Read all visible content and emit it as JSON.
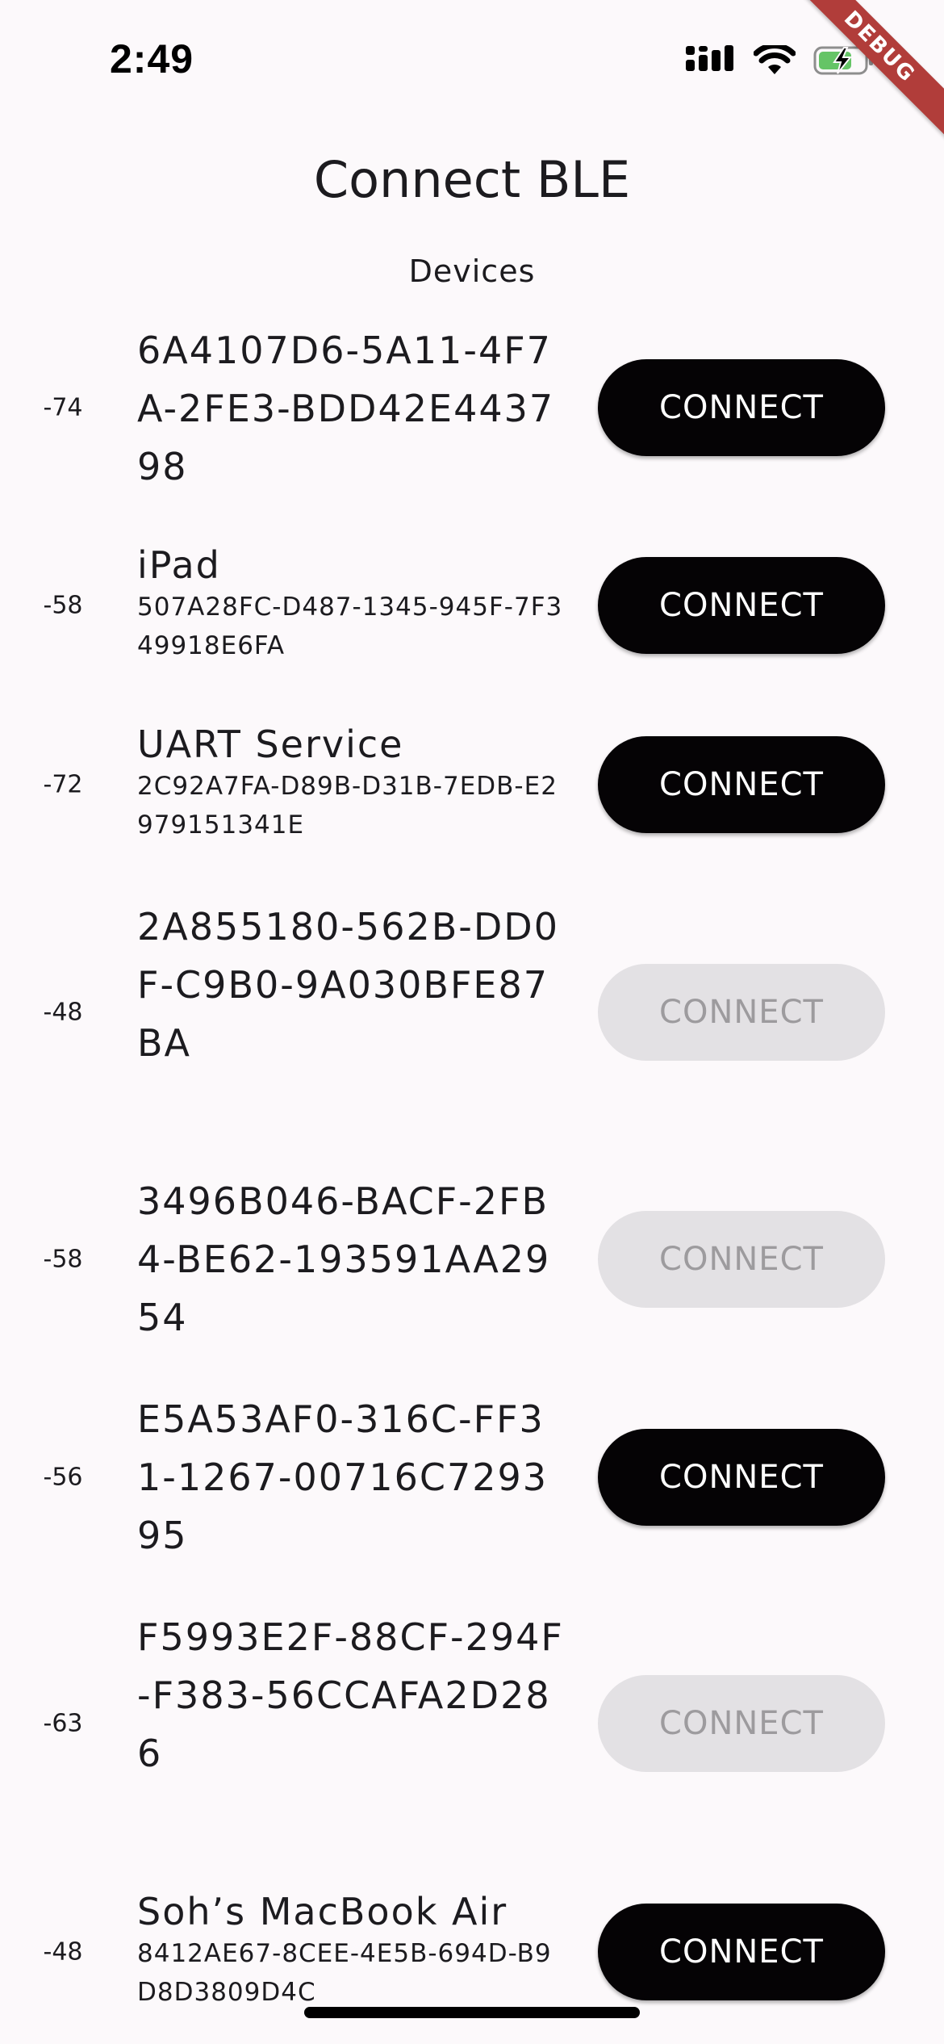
{
  "status_bar": {
    "time": "2:49",
    "debug_label": "DEBUG",
    "battery_color": "#65c466"
  },
  "app": {
    "title": "Connect BLE",
    "section_title": "Devices"
  },
  "devices": [
    {
      "rssi": "-74",
      "name": "6A4107D6-5A11-4F7A-2FE3-BDD42E443798",
      "id": "",
      "button_label": "CONNECT",
      "connectable": true
    },
    {
      "rssi": "-58",
      "name": "iPad",
      "id": "507A28FC-D487-1345-945F-7F349918E6FA",
      "button_label": "CONNECT",
      "connectable": true
    },
    {
      "rssi": "-72",
      "name": "UART Service",
      "id": "2C92A7FA-D89B-D31B-7EDB-E2979151341E",
      "button_label": "CONNECT",
      "connectable": true
    },
    {
      "rssi": "-48",
      "name": "2A855180-562B-DD0F-C9B0-9A030BFE87BA",
      "id": "",
      "button_label": "CONNECT",
      "connectable": false
    },
    {
      "rssi": "-58",
      "name": "3496B046-BACF-2FB4-BE62-193591AA2954",
      "id": "",
      "button_label": "CONNECT",
      "connectable": false
    },
    {
      "rssi": "-56",
      "name": "E5A53AF0-316C-FF31-1267-00716C729395",
      "id": "",
      "button_label": "CONNECT",
      "connectable": true
    },
    {
      "rssi": "-63",
      "name": "F5993E2F-88CF-294F-F383-56CCAFA2D286",
      "id": "",
      "button_label": "CONNECT",
      "connectable": false
    },
    {
      "rssi": "-48",
      "name": "Soh’s MacBook Air",
      "id": "8412AE67-8CEE-4E5B-694D-B9D8D3809D4C",
      "button_label": "CONNECT",
      "connectable": true
    }
  ]
}
